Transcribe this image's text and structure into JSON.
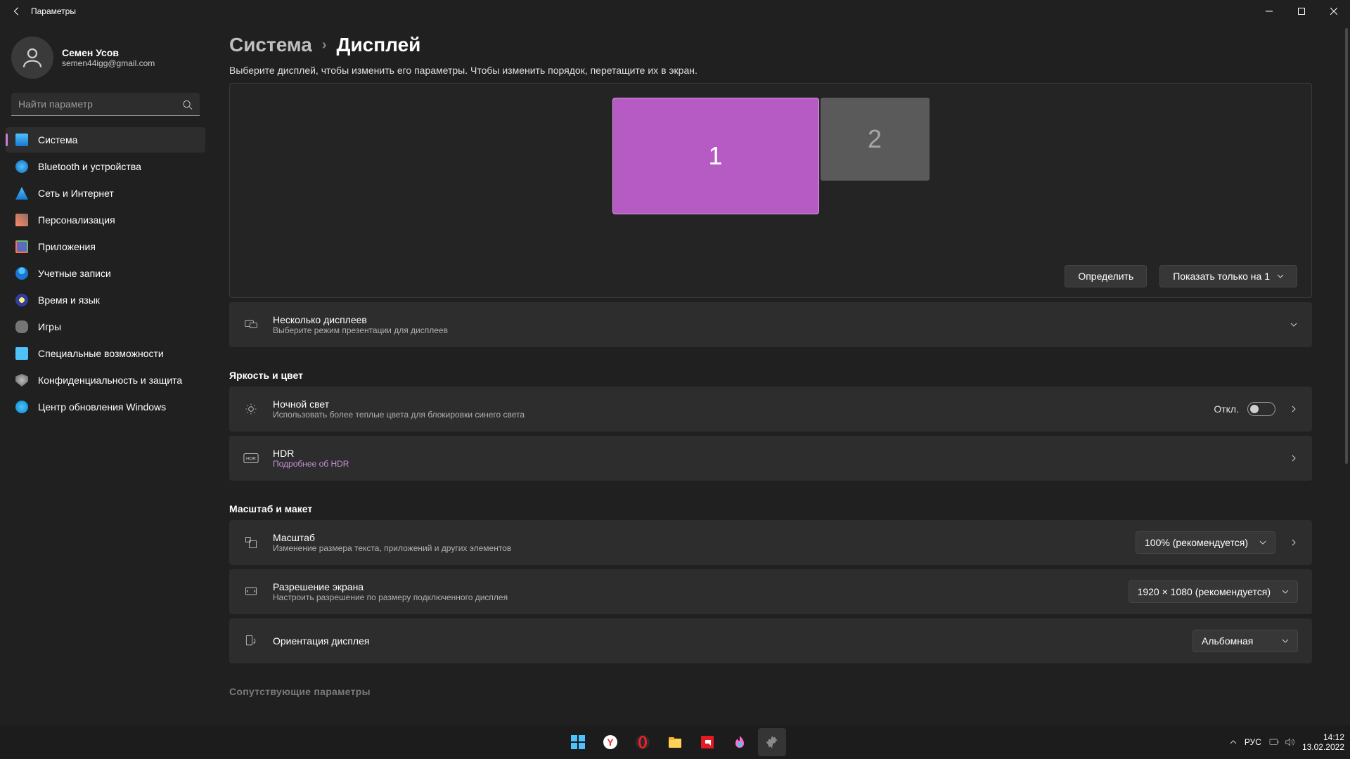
{
  "window": {
    "title": "Параметры"
  },
  "user": {
    "name": "Семен Усов",
    "email": "semen44igg@gmail.com"
  },
  "search": {
    "placeholder": "Найти параметр"
  },
  "nav": [
    {
      "label": "Система",
      "icon": "ic-system",
      "active": true
    },
    {
      "label": "Bluetooth и устройства",
      "icon": "ic-bt"
    },
    {
      "label": "Сеть и Интернет",
      "icon": "ic-net"
    },
    {
      "label": "Персонализация",
      "icon": "ic-pers"
    },
    {
      "label": "Приложения",
      "icon": "ic-apps"
    },
    {
      "label": "Учетные записи",
      "icon": "ic-acct"
    },
    {
      "label": "Время и язык",
      "icon": "ic-time"
    },
    {
      "label": "Игры",
      "icon": "ic-games"
    },
    {
      "label": "Специальные возможности",
      "icon": "ic-access"
    },
    {
      "label": "Конфиденциальность и защита",
      "icon": "ic-priv"
    },
    {
      "label": "Центр обновления Windows",
      "icon": "ic-update"
    }
  ],
  "breadcrumb": {
    "root": "Система",
    "current": "Дисплей"
  },
  "subtitle": "Выберите дисплей, чтобы изменить его параметры. Чтобы изменить порядок, перетащите их в экран.",
  "displays": {
    "d1": "1",
    "d2": "2",
    "identify": "Определить",
    "modeDropdown": "Показать только на 1"
  },
  "multi": {
    "title": "Несколько дисплеев",
    "sub": "Выберите режим презентации для дисплеев"
  },
  "section_bright": "Яркость и цвет",
  "night": {
    "title": "Ночной свет",
    "sub": "Использовать более теплые цвета для блокировки синего света",
    "state": "Откл."
  },
  "hdr": {
    "title": "HDR",
    "link": "Подробнее об HDR"
  },
  "section_scale": "Масштаб и макет",
  "scale": {
    "title": "Масштаб",
    "sub": "Изменение размера текста, приложений и других элементов",
    "value": "100% (рекомендуется)"
  },
  "resolution": {
    "title": "Разрешение экрана",
    "sub": "Настроить разрешение по размеру подключенного дисплея",
    "value": "1920 × 1080 (рекомендуется)"
  },
  "orientation": {
    "title": "Ориентация дисплея",
    "value": "Альбомная"
  },
  "next_section": "Сопутствующие параметры",
  "tray": {
    "lang": "РУС",
    "time": "14:12",
    "date": "13.02.2022"
  }
}
